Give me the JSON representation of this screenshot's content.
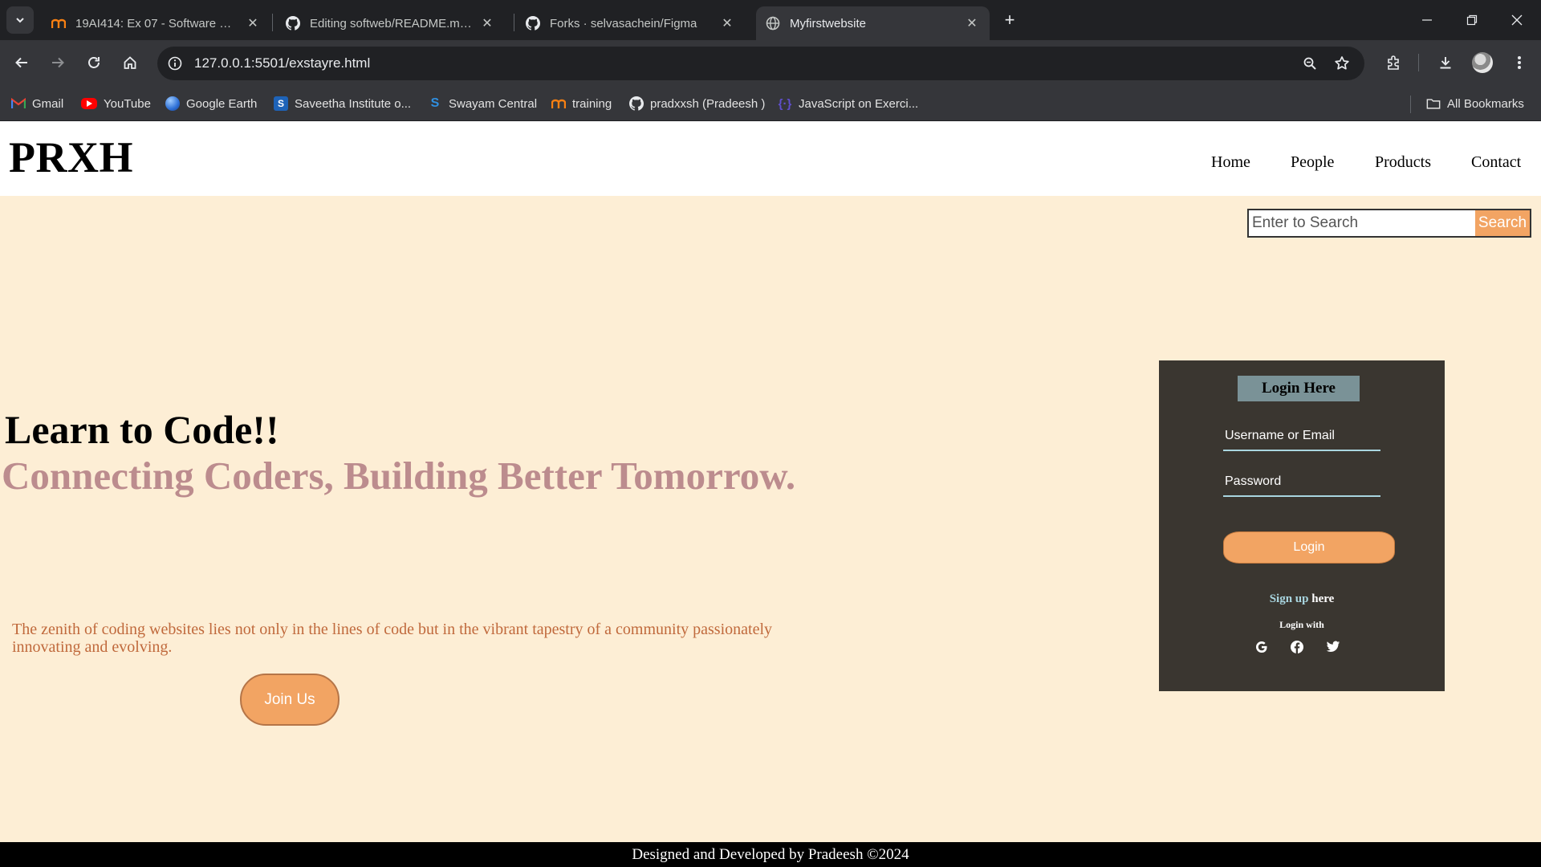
{
  "browser": {
    "tabs": [
      {
        "title": "19AI414: Ex 07 - Software Devel",
        "icon": "moodle-icon",
        "active": false
      },
      {
        "title": "Editing softweb/README.md at",
        "icon": "github-icon",
        "active": false
      },
      {
        "title": "Forks · selvasachein/Figma",
        "icon": "github-icon",
        "active": false
      },
      {
        "title": "Myfirstwebsite",
        "icon": "globe-icon",
        "active": true
      }
    ],
    "url": "127.0.0.1:5501/exstayre.html",
    "bookmarks": [
      {
        "label": "Gmail",
        "icon": "gmail-icon"
      },
      {
        "label": "YouTube",
        "icon": "youtube-icon"
      },
      {
        "label": "Google Earth",
        "icon": "earth-icon"
      },
      {
        "label": "Saveetha Institute o...",
        "icon": "saveetha-icon"
      },
      {
        "label": "Swayam Central",
        "icon": "swayam-icon"
      },
      {
        "label": "training",
        "icon": "moodle-icon"
      },
      {
        "label": "pradxxsh (Pradeesh )",
        "icon": "github-icon"
      },
      {
        "label": "JavaScript on Exerci...",
        "icon": "exercism-icon"
      }
    ],
    "all_bookmarks": "All Bookmarks"
  },
  "site": {
    "logo": "PRXH",
    "nav": [
      "Home",
      "People",
      "Products",
      "Contact"
    ],
    "search": {
      "placeholder": "Enter to Search",
      "button": "Search"
    },
    "hero": {
      "title": "Learn to Code!!",
      "subtitle": "Connecting Coders, Building Better Tomorrow.",
      "text": "The zenith of coding websites lies not only in the lines of code but in the vibrant tapestry of a community passionately innovating and evolving.",
      "button": "Join Us"
    },
    "login": {
      "title": "Login Here",
      "username_placeholder": "Username or Email",
      "password_placeholder": "Password",
      "button": "Login",
      "signup_link": "Sign up",
      "signup_rest": " here",
      "login_with": "Login with"
    },
    "footer": "Designed and Developed by Pradeesh ©2024"
  }
}
